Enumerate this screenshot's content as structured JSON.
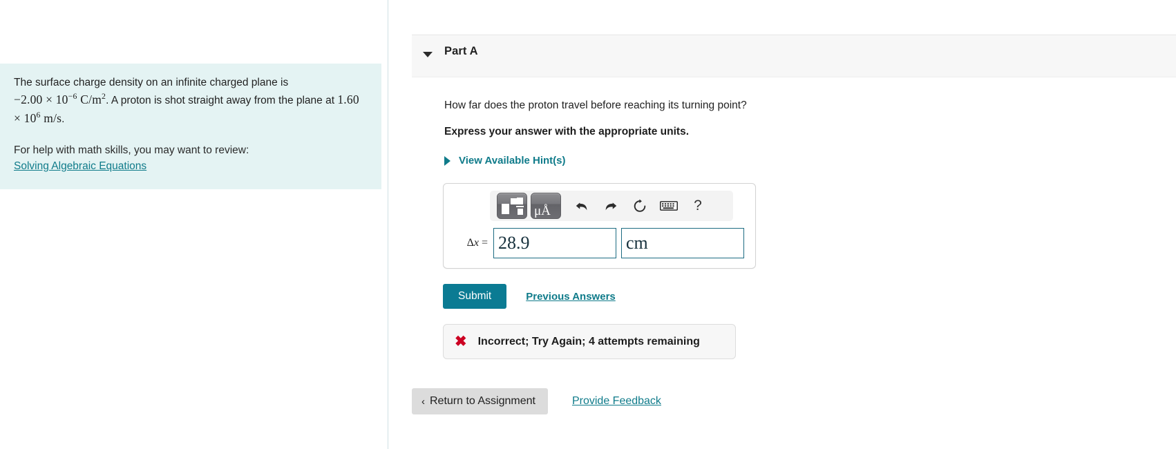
{
  "left": {
    "problem": {
      "line1": "The surface charge density on an infinite charged plane is",
      "charge_density": "−2.00 × 10",
      "charge_density_exp": "−6",
      "charge_density_unit": "C/m",
      "charge_density_unit_exp": "2",
      "line2_tail": ". A proton is shot straight away from the plane at",
      "speed": "1.60 × 10",
      "speed_exp": "6",
      "speed_unit": "m/s",
      "period": "."
    },
    "help": {
      "intro": "For help with math skills, you may want to review:",
      "link_label": "Solving Algebraic Equations"
    }
  },
  "part": {
    "caret_icon": "caret-down-icon",
    "title": "Part A",
    "question": "How far does the proton travel before reaching its turning point?",
    "instruction": "Express your answer with the appropriate units.",
    "hints_caret_icon": "caret-right-icon",
    "hints_label": "View Available Hint(s)"
  },
  "answer": {
    "toolbar": {
      "templates_icon": "math-templates-icon",
      "units_icon": "units-mu-angstrom-icon",
      "units_text": "μÅ",
      "undo_icon": "undo-icon",
      "redo_icon": "redo-icon",
      "reset_icon": "reset-icon",
      "keyboard_icon": "keyboard-icon",
      "help_icon": "question-mark-icon",
      "help_text": "?"
    },
    "label_delta": "Δ",
    "label_var": "x",
    "label_eq": "=",
    "value": "28.9",
    "unit": "cm",
    "value_placeholder": "",
    "unit_placeholder": ""
  },
  "actions": {
    "submit_label": "Submit",
    "previous_answers_label": "Previous Answers"
  },
  "feedback": {
    "icon": "x-mark-icon",
    "icon_glyph": "✖",
    "message": "Incorrect; Try Again; 4 attempts remaining"
  },
  "bottom": {
    "return_chevron": "‹",
    "return_label": "Return to Assignment",
    "provide_feedback_label": "Provide Feedback"
  },
  "colors": {
    "accent_teal": "#0f7b8a",
    "submit_teal": "#0b7b93",
    "question_bg": "#e4f3f3",
    "error_red": "#cc0022",
    "header_bg": "#f7f7f7"
  }
}
